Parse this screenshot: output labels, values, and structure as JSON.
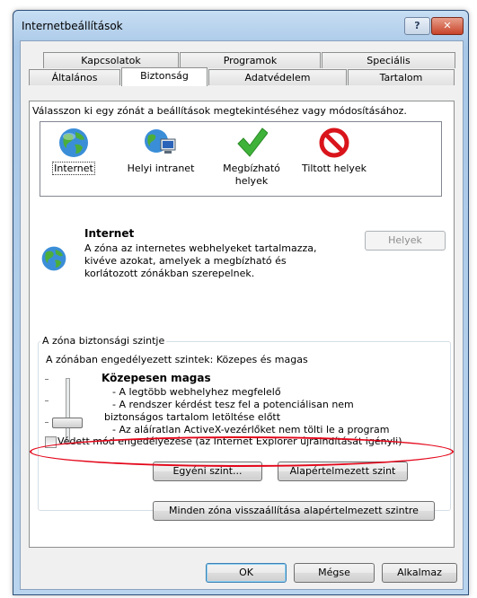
{
  "window": {
    "title": "Internetbeállítások",
    "help_label": "?",
    "close_label": "✕"
  },
  "tabs": {
    "back": [
      "Kapcsolatok",
      "Programok",
      "Speciális"
    ],
    "front": [
      "Általános",
      "Biztonság",
      "Adatvédelem",
      "Tartalom"
    ],
    "active": "Biztonság"
  },
  "zones": {
    "prompt": "Válasszon ki egy zónát a beállítások megtekintéséhez vagy módosításához.",
    "items": [
      {
        "label": "Internet",
        "icon": "globe-icon"
      },
      {
        "label": "Helyi intranet",
        "icon": "intranet-icon"
      },
      {
        "label": "Megbízható helyek",
        "icon": "checkmark-icon"
      },
      {
        "label": "Tiltott helyek",
        "icon": "prohibited-icon"
      }
    ]
  },
  "zone_info": {
    "title": "Internet",
    "description": "A zóna az internetes webhelyeket tartalmazza, kivéve azokat, amelyek a megbízható és korlátozott zónákban szerepelnek.",
    "sites_button": "Helyek"
  },
  "security_level": {
    "group_label": "A zóna biztonsági szintje",
    "allowed": "A zónában engedélyezett szintek: Közepes és magas",
    "level_name": "Közepesen magas",
    "bullets": [
      "- A legtöbb webhelyhez megfelelő",
      "- A rendszer kérdést tesz fel a potenciálisan nem",
      "biztonságos tartalom letöltése előtt",
      "- Az aláíratlan ActiveX-vezérlőket nem tölti le a program"
    ],
    "protected_mode": "Védett mód engedélyezése (az Internet Explorer újraindítását igényli)",
    "protected_mode_checked": false,
    "custom_button": "Egyéni szint...",
    "default_button": "Alapértelmezett szint"
  },
  "reset_all_button": "Minden zóna visszaállítása alapértelmezett szintre",
  "footer": {
    "ok": "OK",
    "cancel": "Mégse",
    "apply": "Alkalmaz"
  },
  "colors": {
    "highlight_ellipse": "#e4061a"
  }
}
